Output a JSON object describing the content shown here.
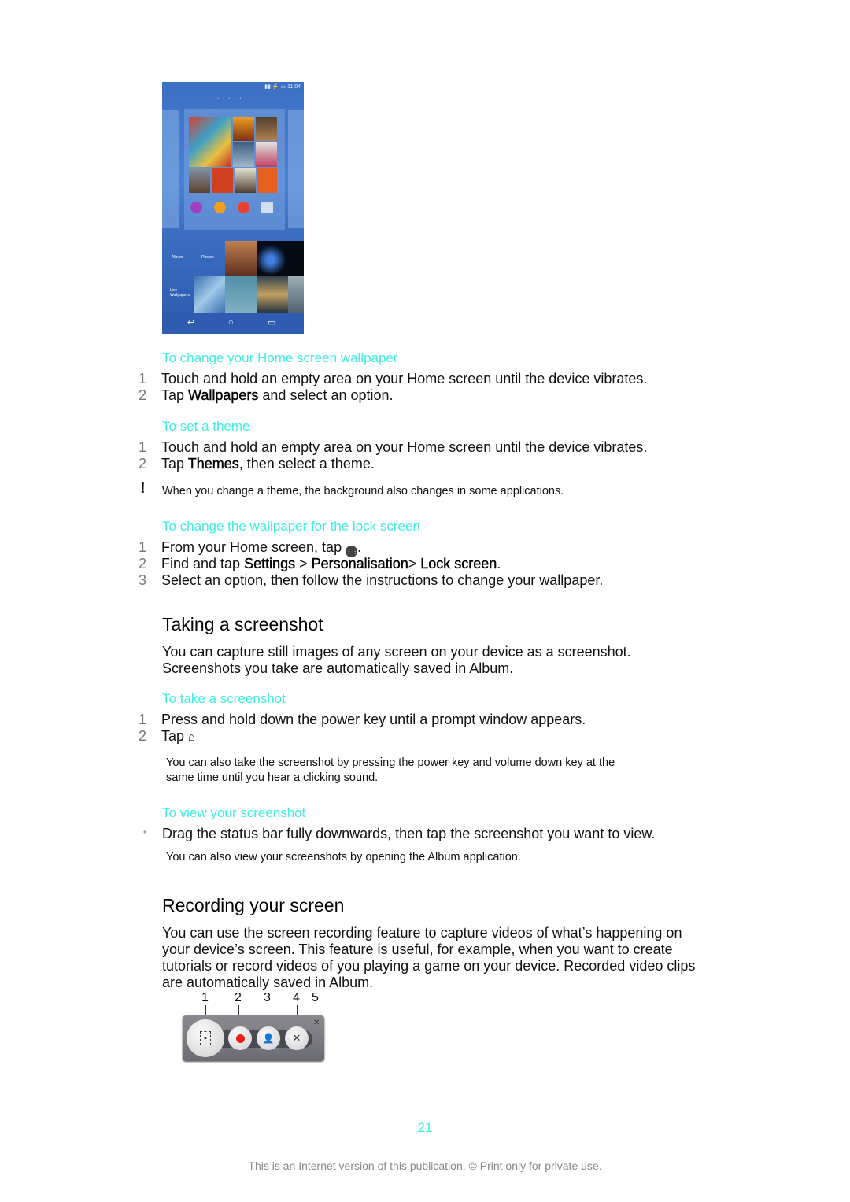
{
  "phone_image": {
    "status_time": "11:04",
    "panel_labels": [
      "Walkman",
      "Album",
      "Movies",
      "Folder"
    ],
    "lower_labels": [
      "Album",
      "Photos",
      "Live Wallpapers"
    ],
    "nav_icons": [
      "back-icon",
      "home-icon",
      "recent-apps-icon"
    ]
  },
  "sections": {
    "home_wallpaper": {
      "heading": "To change your Home screen wallpaper",
      "steps": [
        {
          "num": "1",
          "text": "Touch and hold an empty area on your Home screen until the device vibrates."
        },
        {
          "num": "2",
          "pre": "Tap ",
          "bold": "Wallpapers",
          "post": " and select an option."
        }
      ]
    },
    "set_theme": {
      "heading": "To set a theme",
      "steps": [
        {
          "num": "1",
          "text": "Touch and hold an empty area on your Home screen until the device vibrates."
        },
        {
          "num": "2",
          "pre": "Tap ",
          "bold": "Themes",
          "post": ", then select a theme."
        }
      ],
      "note": "When you change a theme, the background also changes in some applications.",
      "note_icon": "!"
    },
    "lock_wallpaper": {
      "heading": "To change the wallpaper for the lock screen",
      "steps": [
        {
          "num": "1",
          "pre": "From your Home screen, tap ",
          "post": "."
        },
        {
          "num": "2",
          "pre": "Find and tap ",
          "b1": "Settings",
          "sep1": " > ",
          "b2": "Personalisation",
          "sep2": "> ",
          "b3": "Lock screen",
          "post": "."
        },
        {
          "num": "3",
          "text": "Select an option, then follow the instructions to change your wallpaper."
        }
      ]
    },
    "taking_screenshot": {
      "title": "Taking a screenshot",
      "para_line1": "You can capture still images of any screen on your device as a screenshot.",
      "para_line2": "Screenshots you take are automatically saved in Album.",
      "take": {
        "heading": "To take a screenshot",
        "steps": [
          {
            "num": "1",
            "text": "Press and hold down the power key until a prompt window appears."
          },
          {
            "num": "2",
            "pre": "Tap "
          }
        ],
        "tip_line1": "You can also take the screenshot by pressing the power key and volume down key at the",
        "tip_line2": "same time until you hear a clicking sound."
      },
      "view": {
        "heading": "To view your screenshot",
        "bullet": "Drag the status bar fully downwards, then tap the screenshot you want to view.",
        "tip": "You can also view your screenshots by opening the Album application."
      }
    },
    "recording": {
      "title": "Recording your screen",
      "para_lines": [
        "You can use the screen recording feature to capture videos of what’s happening on",
        "your device’s screen. This feature is useful, for example, when you want to create",
        "tutorials or record videos of you playing a game on your device. Recorded video clips",
        "are automatically saved in Album."
      ],
      "callouts": [
        "1",
        "2",
        "3",
        "4",
        "5"
      ]
    }
  },
  "footer": {
    "page_number": "21",
    "notice": "This is an Internet version of this publication. © Print only for private use."
  },
  "colors": {
    "heading_accent": "#3ef0e0",
    "step_number": "#777777",
    "record_red": "#e8201c"
  }
}
